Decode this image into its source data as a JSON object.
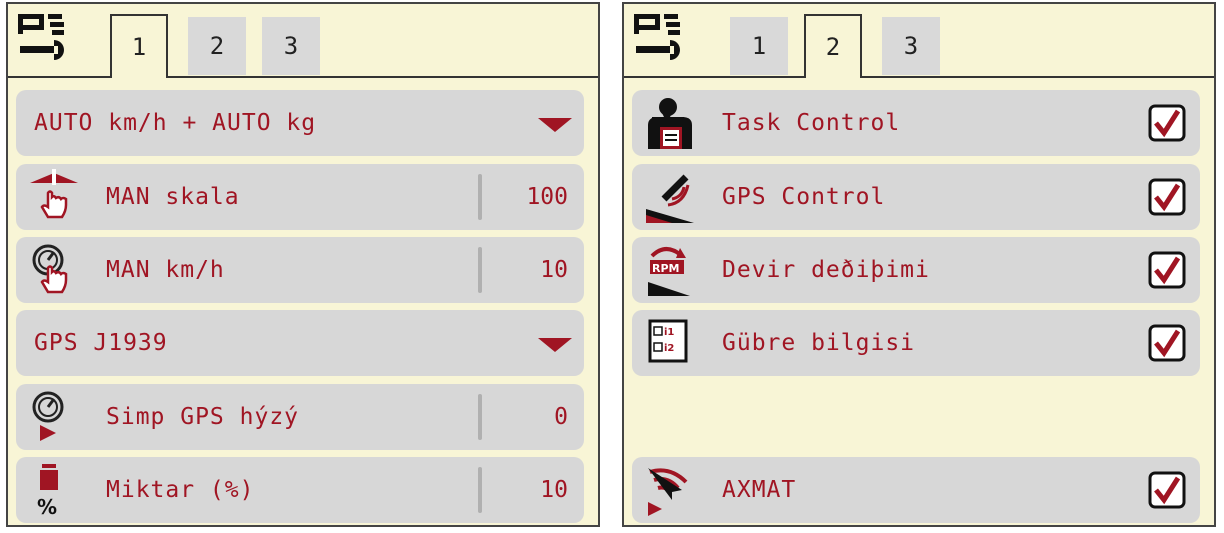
{
  "colors": {
    "panel_bg": "#f8f5d6",
    "row_bg": "#d7d7d7",
    "accent": "#a01523",
    "tab_inactive": "#d9d9d9"
  },
  "left": {
    "tabs": [
      {
        "label": "1",
        "active": true
      },
      {
        "label": "2"
      },
      {
        "label": "3"
      }
    ],
    "rows": {
      "r0": {
        "label": "AUTO km/h + AUTO kg"
      },
      "r1": {
        "label": "MAN skala",
        "value": "100",
        "icon": "manual-scale-hand-icon"
      },
      "r2": {
        "label": "MAN km/h",
        "value": "10",
        "icon": "manual-speed-hand-icon"
      },
      "r3": {
        "label": "GPS J1939"
      },
      "r4": {
        "label": "Simp GPS hýzý",
        "value": "0",
        "icon": "gps-speed-simulation-icon"
      },
      "r5": {
        "label": "Miktar (%)",
        "value": "10",
        "icon": "amount-percent-icon"
      }
    }
  },
  "right": {
    "tabs": [
      {
        "label": "1"
      },
      {
        "label": "2",
        "active": true
      },
      {
        "label": "3"
      }
    ],
    "rows": {
      "r0": {
        "label": "Task Control",
        "checked": true,
        "icon": "task-control-operator-icon"
      },
      "r1": {
        "label": "GPS Control",
        "checked": true,
        "icon": "gps-control-icon"
      },
      "r2": {
        "label": "Devir deðiþimi",
        "checked": true,
        "icon": "rpm-change-icon"
      },
      "r3": {
        "label": "Gübre bilgisi",
        "checked": true,
        "icon": "fertilizer-info-icon"
      },
      "r4": {
        "label": "AXMAT",
        "checked": true,
        "icon": "axmat-wireless-icon"
      }
    }
  }
}
